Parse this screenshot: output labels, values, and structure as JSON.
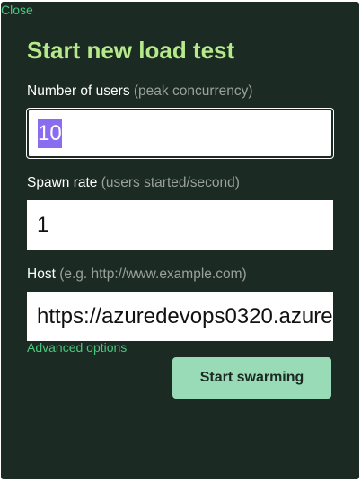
{
  "dialog": {
    "close_label": "Close",
    "title": "Start new load test"
  },
  "fields": {
    "users": {
      "label": "Number of users",
      "hint": "(peak concurrency)",
      "value": "10",
      "selected": true
    },
    "spawn_rate": {
      "label": "Spawn rate",
      "hint": "(users started/second)",
      "value": "1"
    },
    "host": {
      "label": "Host",
      "hint": "(e.g. http://www.example.com)",
      "value": "https://azuredevops0320.azure"
    }
  },
  "advanced_label": "Advanced options",
  "start_button_label": "Start swarming",
  "colors": {
    "background": "#1b2a22",
    "title": "#b6e98a",
    "link": "#4ac77f",
    "button": "#99dbb7",
    "selection": "#8a6cf0"
  }
}
